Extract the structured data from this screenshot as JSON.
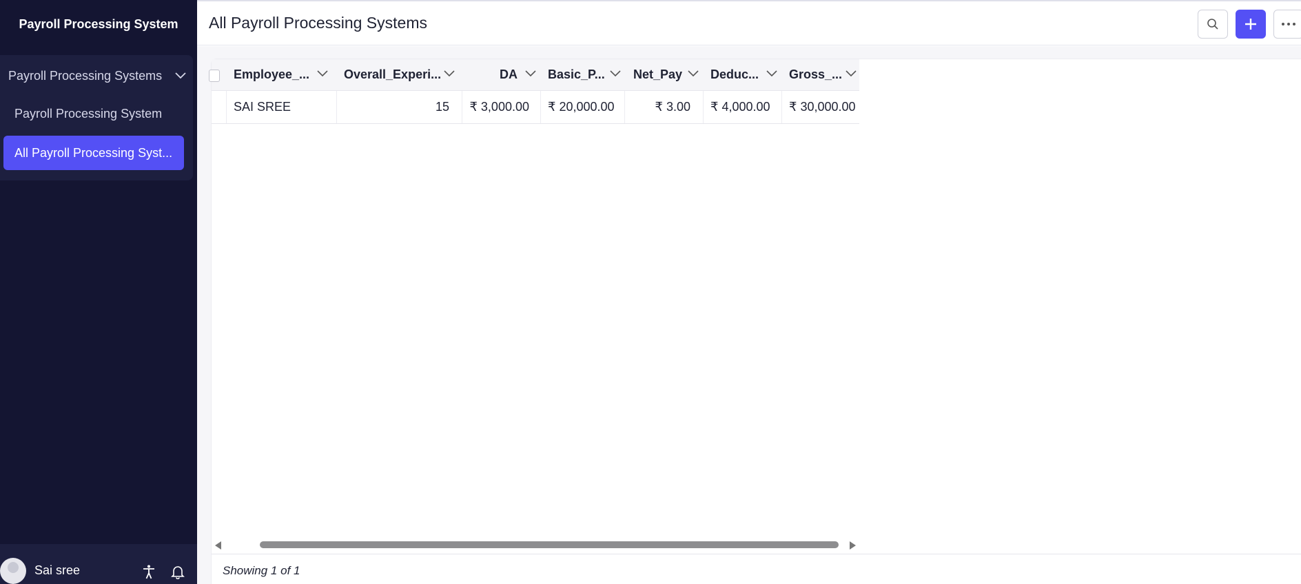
{
  "sidebar": {
    "title": "Payroll Processing System",
    "group_label": "Payroll Processing Systems",
    "items": [
      {
        "label": "Payroll Processing System"
      },
      {
        "label": "All Payroll Processing Syst..."
      }
    ],
    "user_name": "Sai sree",
    "icons": [
      "accessibility-icon",
      "bell-icon"
    ]
  },
  "header": {
    "title": "All Payroll Processing Systems",
    "buttons": [
      "search-icon",
      "plus-icon",
      "more-icon"
    ]
  },
  "grid": {
    "columns": [
      "Employee_...",
      "Overall_Experi...",
      "DA",
      "Basic_P...",
      "Net_Pay",
      "Deduc...",
      "Gross_..."
    ],
    "rows": [
      [
        "SAI SREE",
        "15",
        "₹ 3,000.00",
        "₹ 20,000.00",
        "₹ 3.00",
        "₹ 4,000.00",
        "₹ 30,000.00"
      ]
    ]
  },
  "footer": {
    "showing": "Showing 1 of 1"
  },
  "colors": {
    "sidebar_bg": "#141532",
    "sidebar_group_bg": "#1d1f3f",
    "accent": "#5450f5"
  }
}
